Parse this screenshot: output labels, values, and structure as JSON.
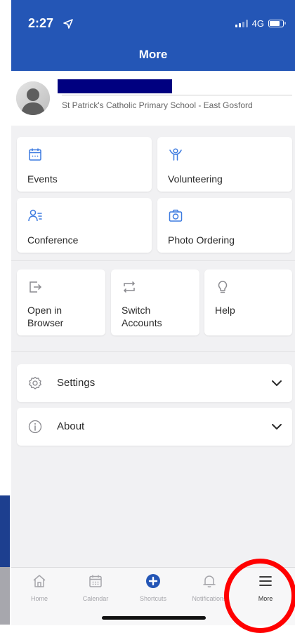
{
  "status_bar": {
    "time": "2:27",
    "network": "4G"
  },
  "header": {
    "title": "More"
  },
  "profile": {
    "school": "St Patrick's Catholic Primary School - East Gosford"
  },
  "grid_two": [
    {
      "label": "Events",
      "icon": "calendar-icon"
    },
    {
      "label": "Volunteering",
      "icon": "volunteer-icon"
    },
    {
      "label": "Conference",
      "icon": "conference-icon"
    },
    {
      "label": "Photo Ordering",
      "icon": "camera-icon"
    }
  ],
  "grid_three": [
    {
      "label_line1": "Open in",
      "label_line2": "Browser",
      "icon": "open-external-icon"
    },
    {
      "label_line1": "Switch",
      "label_line2": "Accounts",
      "icon": "switch-icon"
    },
    {
      "label_line1": "Help",
      "label_line2": "",
      "icon": "lightbulb-icon"
    }
  ],
  "accordions": [
    {
      "label": "Settings",
      "icon": "gear-icon"
    },
    {
      "label": "About",
      "icon": "info-icon"
    }
  ],
  "tabs": [
    {
      "label": "Home",
      "icon": "home-icon"
    },
    {
      "label": "Calendar",
      "icon": "calendar-icon"
    },
    {
      "label": "Shortcuts",
      "icon": "plus-circle-icon"
    },
    {
      "label": "Notifications",
      "icon": "bell-icon"
    },
    {
      "label": "More",
      "icon": "menu-icon"
    }
  ],
  "colors": {
    "brand_blue": "#2456b6",
    "icon_blue": "#3d7be0",
    "redaction": "#000080",
    "highlight_circle": "#ff0000"
  }
}
